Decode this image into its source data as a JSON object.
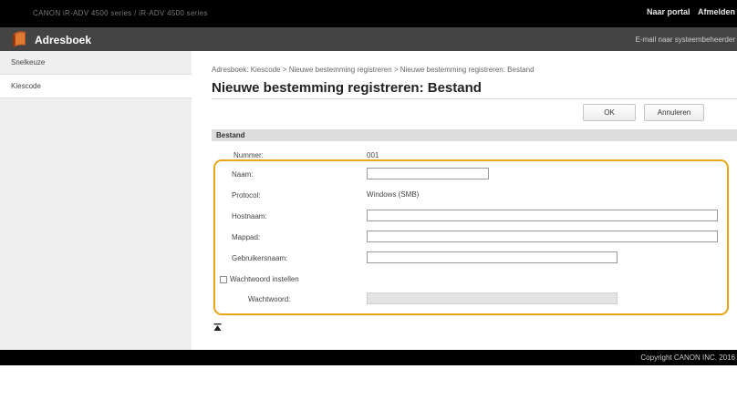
{
  "topbar": {
    "device_name": "CANON iR-ADV 4500 series / iR-ADV 4500 series",
    "links": [
      "Naar portal",
      "Afmelden"
    ]
  },
  "app": {
    "title": "Adresboek",
    "icon": "address-book-icon",
    "mail_link": "E-mail naar systeembeheerder"
  },
  "sidebar": {
    "items": [
      {
        "label": "Snelkeuze",
        "active": false
      },
      {
        "label": "Kiescode",
        "active": true
      }
    ]
  },
  "main": {
    "breadcrumb": "Adresboek: Kiescode > Nieuwe bestemming registreren > Nieuwe bestemming registreren: Bestand",
    "title": "Nieuwe bestemming registreren: Bestand",
    "buttons": {
      "ok": "OK",
      "cancel": "Annuleren"
    },
    "section": "Bestand",
    "fields": {
      "nummer_label": "Nummer:",
      "nummer_value": "001",
      "naam_label": "Naam:",
      "naam_value": "",
      "protocol_label": "Protocol:",
      "protocol_value": "Windows (SMB)",
      "hostnaam_label": "Hostnaam:",
      "hostnaam_value": "",
      "map_label": "Mappad:",
      "map_value": "",
      "gebruiker_label": "Gebruikersnaam:",
      "gebruiker_value": "",
      "wachtwoord_check_label": "Wachtwoord instellen",
      "wachtwoord_checked": false,
      "wachtwoord_label": "Wachtwoord:",
      "wachtwoord_value": ""
    }
  },
  "footer": {
    "copyright": "Copyright CANON INC. 2016"
  },
  "colors": {
    "highlight": "#eba417",
    "topbar": "#000000",
    "appbar": "#444444"
  }
}
